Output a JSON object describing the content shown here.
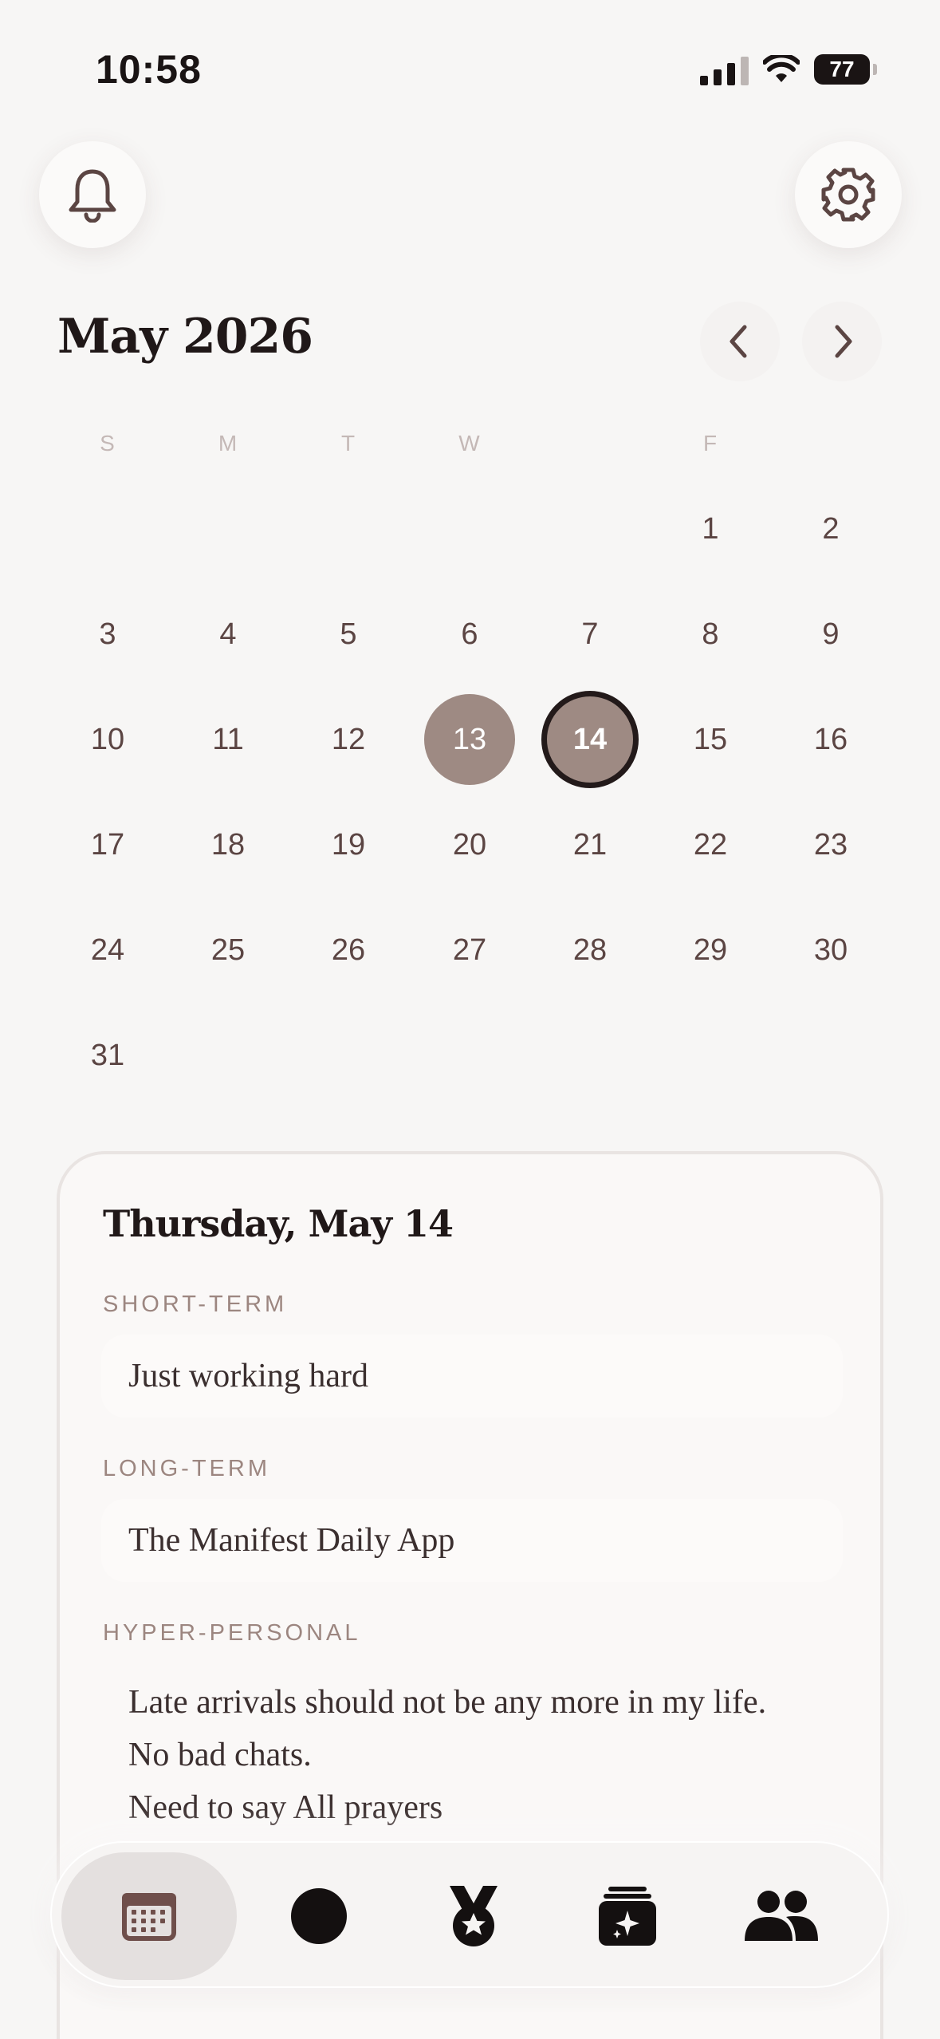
{
  "status_bar": {
    "time": "10:58",
    "battery": "77"
  },
  "header": {
    "month_title": "May 2026"
  },
  "calendar": {
    "weekdays": [
      "S",
      "M",
      "T",
      "W",
      "",
      "F",
      ""
    ],
    "days": [
      "1",
      "2",
      "3",
      "4",
      "5",
      "6",
      "7",
      "8",
      "9",
      "10",
      "11",
      "12",
      "13",
      "14",
      "15",
      "16",
      "17",
      "18",
      "19",
      "20",
      "21",
      "22",
      "23",
      "24",
      "25",
      "26",
      "27",
      "28",
      "29",
      "30",
      "31"
    ],
    "selected_day": "14",
    "previous_selected_day": "13"
  },
  "day_card": {
    "title": "Thursday, May 14",
    "sections": [
      {
        "label": "SHORT-TERM",
        "value": "Just working hard"
      },
      {
        "label": "LONG-TERM",
        "value": "The Manifest Daily App"
      },
      {
        "label": "HYPER-PERSONAL",
        "lines": [
          "Late arrivals should not be any more in my life.",
          "No bad chats.",
          "Need to say All prayers"
        ]
      }
    ]
  },
  "tab_bar": {
    "items": [
      {
        "icon": "calendar-icon",
        "active": true
      },
      {
        "icon": "circle-icon",
        "active": false
      },
      {
        "icon": "medal-icon",
        "active": false
      },
      {
        "icon": "sparkle-cards-icon",
        "active": false
      },
      {
        "icon": "people-icon",
        "active": false
      }
    ]
  },
  "colors": {
    "accent": "#9e8a83",
    "text": "#5b4543",
    "heading": "#201818",
    "background": "#f7f6f5"
  }
}
